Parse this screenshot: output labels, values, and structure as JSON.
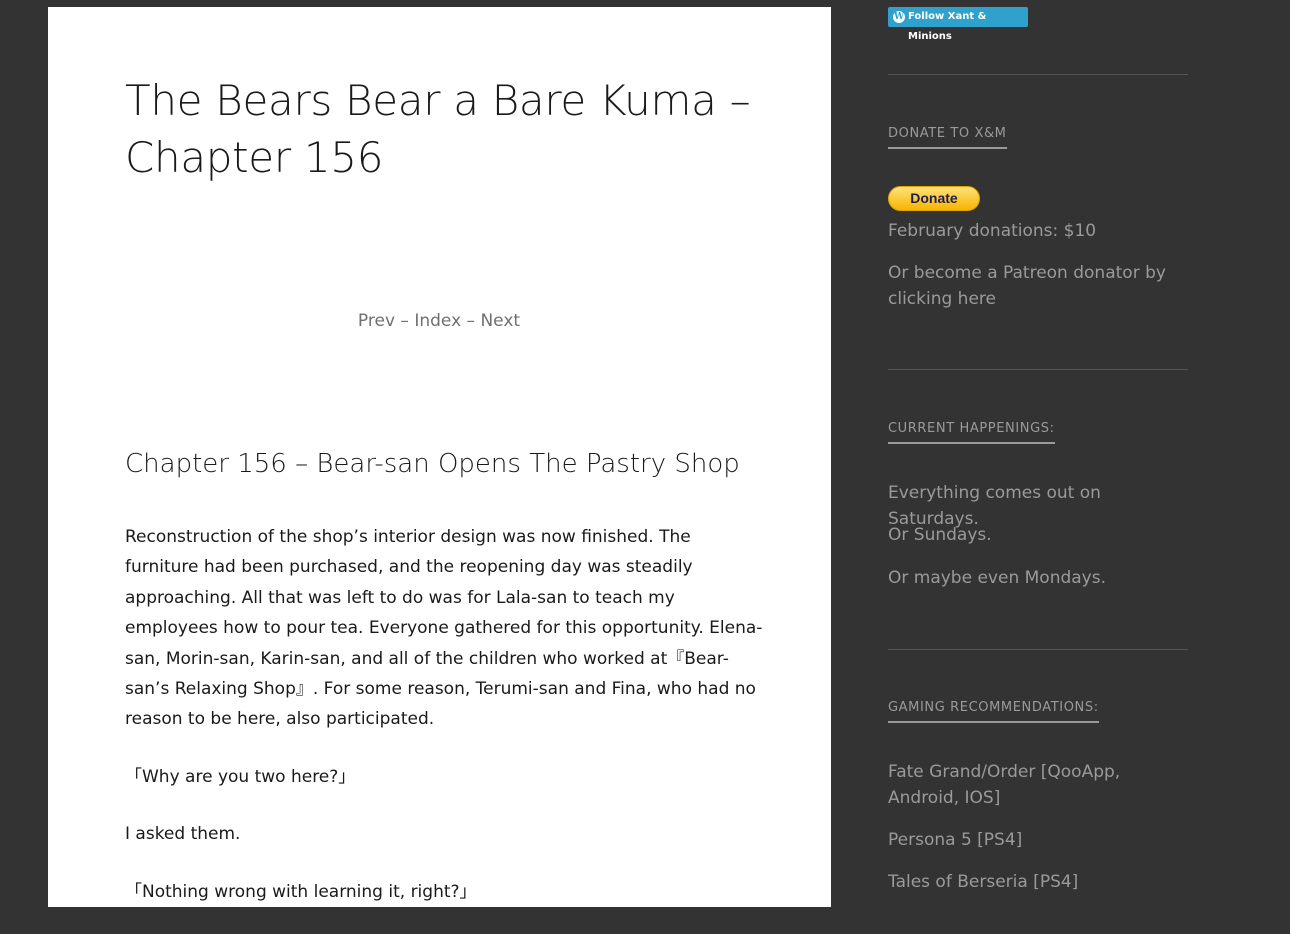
{
  "article": {
    "title": "The Bears Bear a Bare Kuma – Chapter 156",
    "nav": {
      "prev": "Prev",
      "sep1": " – ",
      "index": "Index",
      "sep2": " – ",
      "next": "Next"
    },
    "chapter_heading": "Chapter 156 – Bear-san Opens The Pastry Shop",
    "paragraphs": [
      "Reconstruction of the shop’s interior design was now finished. The furniture had been purchased, and the reopening day was steadily approaching. All that was left to do was for Lala-san to teach my employees how to pour tea. Everyone gathered for this opportunity. Elena-san, Morin-san, Karin-san, and all of the children who worked at『Bear-san’s Relaxing Shop』. For some reason, Terumi-san and Fina, who had no reason to be here, also participated.",
      "「Why are you two here?」",
      "I asked them.",
      "「Nothing wrong with learning it, right?」"
    ]
  },
  "sidebar": {
    "follow_label": "Follow Xant & Minions",
    "donate_title": "DONATE TO X&M",
    "donate_button": "Donate",
    "donations_text": "February donations: $10",
    "patreon_text": "Or become a Patreon donator by clicking here",
    "happenings_title": "CURRENT HAPPENINGS:",
    "happenings": [
      "Everything comes out on Saturdays.",
      "Or Sundays.",
      "Or maybe even Mondays."
    ],
    "gaming_title": "GAMING RECOMMENDATIONS:",
    "gaming": [
      "Fate Grand/Order [QooApp, Android, IOS]",
      "Persona 5 [PS4]",
      "Tales of Berseria [PS4]"
    ]
  },
  "colors": {
    "background": "#333333",
    "article_bg": "#ffffff",
    "follow_button": "#2ea2cc",
    "donate_button": "#ffc439"
  }
}
